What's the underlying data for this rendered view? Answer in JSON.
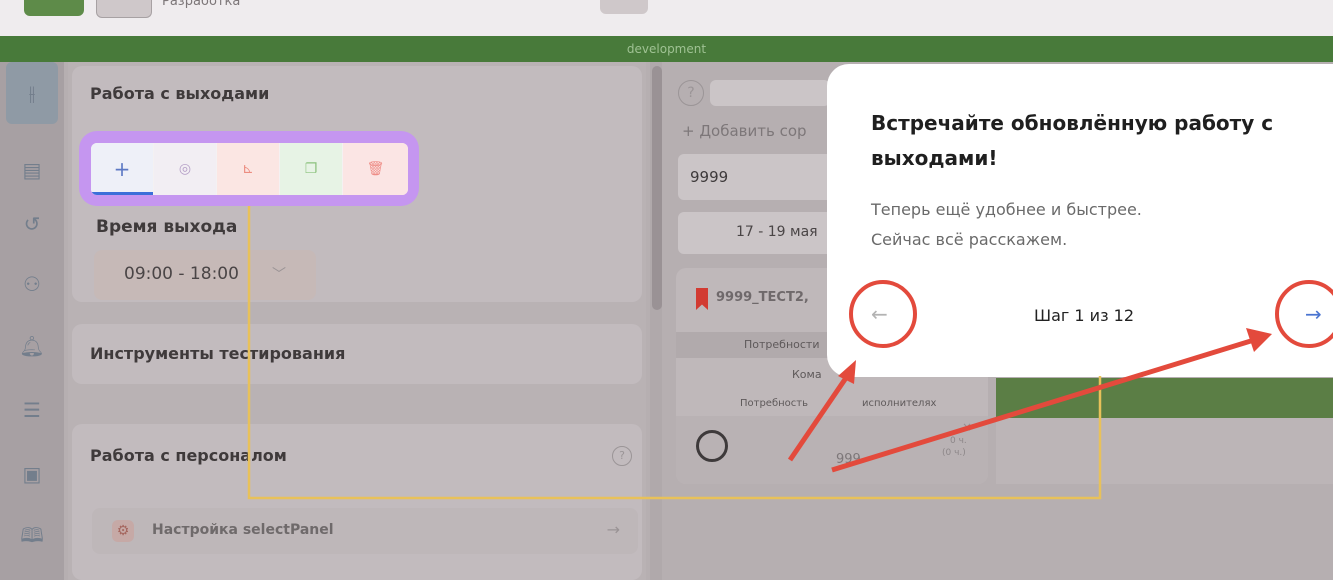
{
  "topbar": {
    "partial_text": "Разработка"
  },
  "env_banner": {
    "label": "development"
  },
  "left_panel": {
    "exits_card": {
      "title": "Работа с выходами"
    },
    "exit_time": {
      "label": "Время выхода",
      "value": "09:00 - 18:00"
    },
    "testing_tools": {
      "title": "Инструменты тестирования"
    },
    "staff_card": {
      "title": "Работа с персоналом",
      "help": "?",
      "settings_item": {
        "label": "Настройка selectPanel",
        "arrow": "→"
      }
    }
  },
  "toolbar": {
    "add_glyph": "+",
    "buttons": [
      {
        "name": "add",
        "icon": "plus-icon"
      },
      {
        "name": "assign",
        "icon": "face-scan-icon"
      },
      {
        "name": "move",
        "icon": "boot-icon"
      },
      {
        "name": "copy",
        "icon": "copy-icon"
      },
      {
        "name": "delete",
        "icon": "trash-icon"
      }
    ]
  },
  "mid_panel": {
    "help": "?",
    "add_sort": "+ Добавить сор",
    "search_value": "9999",
    "date_range": "17 - 19 мая",
    "order": {
      "title": "9999_ТЕСТ2,",
      "rows": [
        "Потребности",
        "Кома",
        "Потребность",
        "исполнителях"
      ]
    },
    "employee": {
      "id": "999",
      "hours": "0 ч.",
      "hours_paren": "(0 ч.)",
      "close": "×"
    }
  },
  "onboarding": {
    "title": "Встречайте обновлённую работу с выходами!",
    "line1": "Теперь ещё удобнее и быстрее.",
    "line2": "Сейчас всё расскажем.",
    "step": "Шаг 1 из 12",
    "prev": "←",
    "next": "→"
  },
  "colors": {
    "highlight": "#c596f0",
    "annotation_red": "#e34a3c",
    "annotation_yellow": "#e8c15a",
    "env_green": "#487a3a"
  }
}
